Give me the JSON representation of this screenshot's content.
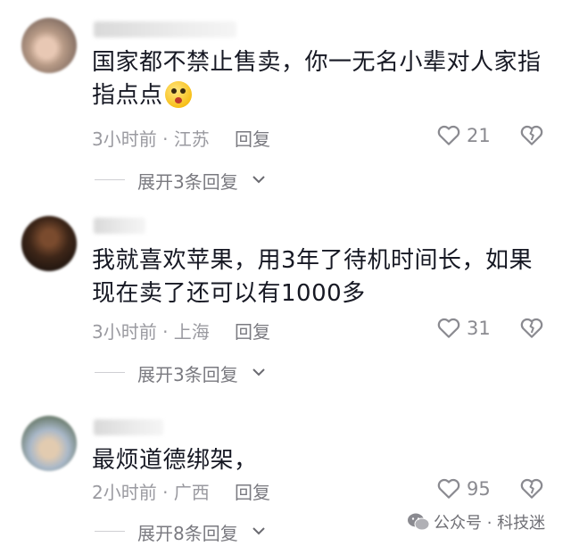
{
  "comments": [
    {
      "text": "国家都不禁止售卖，你一无名小辈对人家指指点点",
      "emoji": "shocked-face-emoji",
      "time_location": "3小时前 · 江苏",
      "reply_label": "回复",
      "likes": "21",
      "expand_label": "展开3条回复"
    },
    {
      "text": "我就喜欢苹果，用3年了待机时间长，如果现在卖了还可以有1000多",
      "time_location": "3小时前 · 上海",
      "reply_label": "回复",
      "likes": "31",
      "expand_label": "展开3条回复"
    },
    {
      "text": "最烦道德绑架，",
      "time_location": "2小时前 · 广西",
      "reply_label": "回复",
      "likes": "95",
      "expand_label": "展开8条回复"
    }
  ],
  "watermark": {
    "text": "公众号 · 科技迷",
    "icon": "wechat-icon"
  },
  "colors": {
    "text": "#161823",
    "meta": "#9a9aa0",
    "icon": "#8a8a90"
  }
}
